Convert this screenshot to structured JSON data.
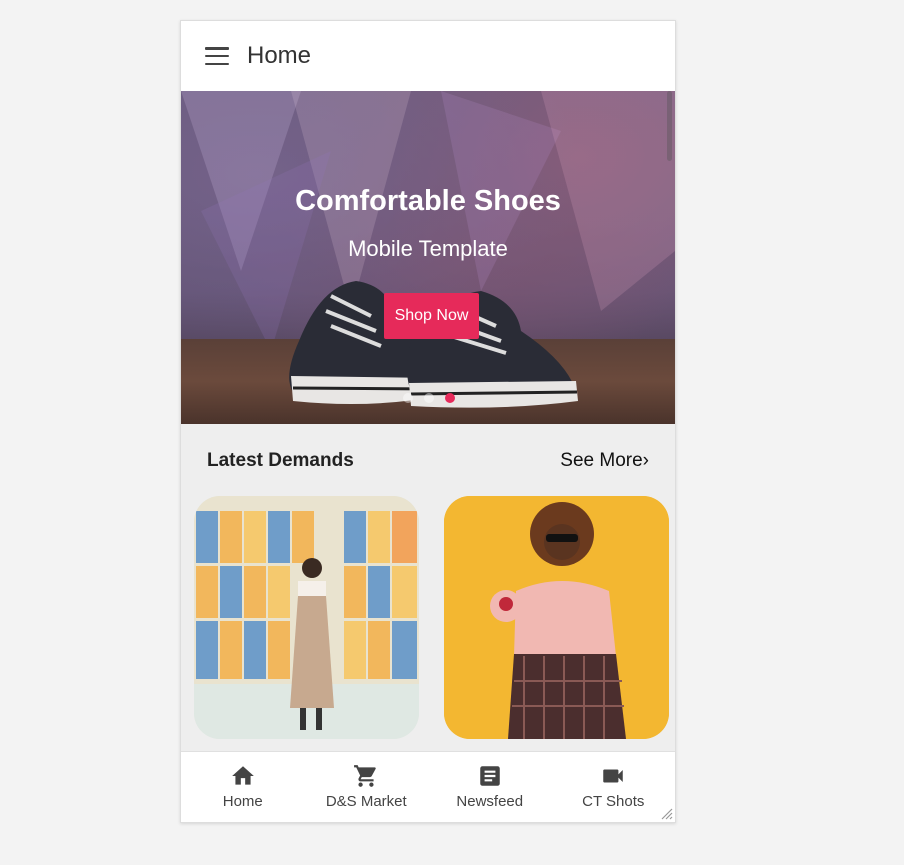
{
  "header": {
    "title": "Home",
    "menu_icon": "hamburger-menu-icon"
  },
  "hero": {
    "title": "Comfortable Shoes",
    "subtitle": "Mobile Template",
    "cta_label": "Shop Now",
    "slide_count": 3,
    "active_slide": 3
  },
  "section": {
    "title": "Latest Demands",
    "see_more": "See More›"
  },
  "products": [
    {
      "image": "woman-with-lockers-photo"
    },
    {
      "image": "woman-with-sunglasses-photo"
    }
  ],
  "bottom_nav": [
    {
      "label": "Home",
      "icon": "home-icon"
    },
    {
      "label": "D&S Market",
      "icon": "cart-icon"
    },
    {
      "label": "Newsfeed",
      "icon": "article-icon"
    },
    {
      "label": "CT Shots",
      "icon": "video-camera-icon"
    }
  ],
  "colors": {
    "accent": "#e62a5a",
    "background": "#eeeeee",
    "appbar": "#ffffff",
    "text": "#333333"
  }
}
